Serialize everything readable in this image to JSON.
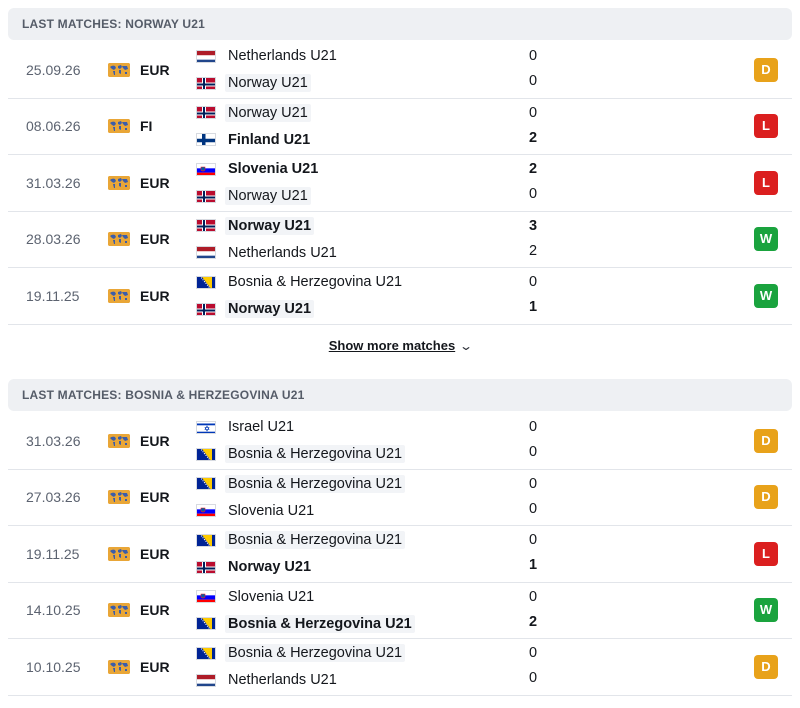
{
  "sections": [
    {
      "title": "LAST MATCHES: NORWAY U21",
      "matches": [
        {
          "date": "25.09.26",
          "comp": "EUR",
          "home": {
            "name": "Netherlands U21",
            "flag": "nl",
            "hl": false,
            "bold": false
          },
          "away": {
            "name": "Norway U21",
            "flag": "no",
            "hl": true,
            "bold": false
          },
          "home_score": "0",
          "away_score": "0",
          "result": "D"
        },
        {
          "date": "08.06.26",
          "comp": "FI",
          "home": {
            "name": "Norway U21",
            "flag": "no",
            "hl": true,
            "bold": false
          },
          "away": {
            "name": "Finland U21",
            "flag": "fi",
            "hl": false,
            "bold": true
          },
          "home_score": "0",
          "away_score": "2",
          "result": "L"
        },
        {
          "date": "31.03.26",
          "comp": "EUR",
          "home": {
            "name": "Slovenia U21",
            "flag": "si",
            "hl": false,
            "bold": true
          },
          "away": {
            "name": "Norway U21",
            "flag": "no",
            "hl": true,
            "bold": false
          },
          "home_score": "2",
          "away_score": "0",
          "result": "L"
        },
        {
          "date": "28.03.26",
          "comp": "EUR",
          "home": {
            "name": "Norway U21",
            "flag": "no",
            "hl": true,
            "bold": true
          },
          "away": {
            "name": "Netherlands U21",
            "flag": "nl",
            "hl": false,
            "bold": false
          },
          "home_score": "3",
          "away_score": "2",
          "result": "W"
        },
        {
          "date": "19.11.25",
          "comp": "EUR",
          "home": {
            "name": "Bosnia & Herzegovina U21",
            "flag": "ba",
            "hl": false,
            "bold": false
          },
          "away": {
            "name": "Norway U21",
            "flag": "no",
            "hl": true,
            "bold": true
          },
          "home_score": "0",
          "away_score": "1",
          "result": "W"
        }
      ]
    },
    {
      "title": "LAST MATCHES: BOSNIA & HERZEGOVINA U21",
      "matches": [
        {
          "date": "31.03.26",
          "comp": "EUR",
          "home": {
            "name": "Israel U21",
            "flag": "il",
            "hl": false,
            "bold": false
          },
          "away": {
            "name": "Bosnia & Herzegovina U21",
            "flag": "ba",
            "hl": true,
            "bold": false
          },
          "home_score": "0",
          "away_score": "0",
          "result": "D"
        },
        {
          "date": "27.03.26",
          "comp": "EUR",
          "home": {
            "name": "Bosnia & Herzegovina U21",
            "flag": "ba",
            "hl": true,
            "bold": false
          },
          "away": {
            "name": "Slovenia U21",
            "flag": "si",
            "hl": false,
            "bold": false
          },
          "home_score": "0",
          "away_score": "0",
          "result": "D"
        },
        {
          "date": "19.11.25",
          "comp": "EUR",
          "home": {
            "name": "Bosnia & Herzegovina U21",
            "flag": "ba",
            "hl": true,
            "bold": false
          },
          "away": {
            "name": "Norway U21",
            "flag": "no",
            "hl": false,
            "bold": true
          },
          "home_score": "0",
          "away_score": "1",
          "result": "L"
        },
        {
          "date": "14.10.25",
          "comp": "EUR",
          "home": {
            "name": "Slovenia U21",
            "flag": "si",
            "hl": false,
            "bold": false
          },
          "away": {
            "name": "Bosnia & Herzegovina U21",
            "flag": "ba",
            "hl": true,
            "bold": true
          },
          "home_score": "0",
          "away_score": "2",
          "result": "W"
        },
        {
          "date": "10.10.25",
          "comp": "EUR",
          "home": {
            "name": "Bosnia & Herzegovina U21",
            "flag": "ba",
            "hl": true,
            "bold": false
          },
          "away": {
            "name": "Netherlands U21",
            "flag": "nl",
            "hl": false,
            "bold": false
          },
          "home_score": "0",
          "away_score": "0",
          "result": "D"
        }
      ]
    }
  ],
  "show_more_label": "Show more matches",
  "icons": {
    "competition": "world-map-icon",
    "show_more": "chevron-down-icon"
  },
  "colors": {
    "draw": "#e8a21a",
    "loss": "#db1f1f",
    "win": "#1aa33e",
    "header_bg": "#eef0f3"
  }
}
